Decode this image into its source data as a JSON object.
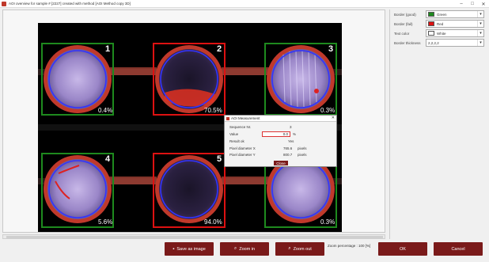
{
  "window": {
    "title": "AOI overview for sample # [2227] created with method [AOI Method copy 3D]",
    "minimize": "–",
    "maximize": "□",
    "close": "✕"
  },
  "properties": [
    {
      "label": "Border (good)",
      "value": "Green",
      "color": "#1e8a1e"
    },
    {
      "label": "Border (fail)",
      "value": "Red",
      "color": "#dd1111"
    },
    {
      "label": "Text color",
      "value": "White",
      "color": "#ffffff"
    },
    {
      "label": "Border thickness",
      "value": "2,2,2,2",
      "color": ""
    }
  ],
  "wells": [
    {
      "number": "1",
      "percent": "0.4%",
      "status": "good"
    },
    {
      "number": "2",
      "percent": "70.5%",
      "status": "fail"
    },
    {
      "number": "3",
      "percent": "0.3%",
      "status": "good"
    },
    {
      "number": "4",
      "percent": "5.6%",
      "status": "good"
    },
    {
      "number": "5",
      "percent": "94.0%",
      "status": "fail"
    },
    {
      "number": "6",
      "percent": "0.3%",
      "status": "good"
    }
  ],
  "colors": {
    "good": "#1e8a1e",
    "fail": "#dd1111",
    "button": "#7a1a1a",
    "circle": "#3333ff",
    "rim": "#c0392b"
  },
  "dialog": {
    "title": "AOI Measurement",
    "sequence_label": "Sequence Nr.",
    "sequence_value": "3",
    "value_label": "Value",
    "value_value": "0.0",
    "value_unit": "%",
    "result_label": "Result ok",
    "result_value": "Yes",
    "diam_x_label": "Pixel diameter X",
    "diam_x_value": "765.6",
    "diam_x_unit": "pixels",
    "diam_y_label": "Pixel diameter Y",
    "diam_y_value": "800.7",
    "diam_y_unit": "pixels",
    "close_label": "Close",
    "close_x": "✕"
  },
  "buttons": {
    "save_image": "Save as image",
    "zoom_in": "Zoom in",
    "zoom_out": "Zoom out",
    "ok": "OK",
    "cancel": "Cancel"
  },
  "zoom_status": "Zoom percentage : 100 [%]"
}
